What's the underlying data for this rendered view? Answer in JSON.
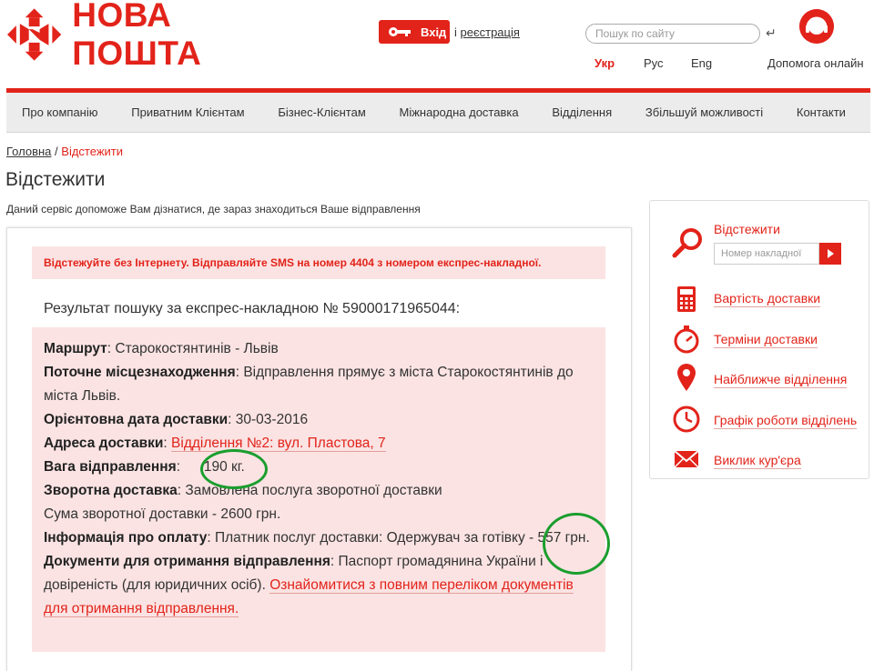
{
  "header": {
    "logo_text": "НОВА ПОШТА",
    "login_label": "Вхід",
    "register_prefix": "і",
    "register_link": "реєстрація",
    "search_placeholder": "Пошук по сайту",
    "languages": [
      "Укр",
      "Рус",
      "Eng"
    ],
    "help_label": "Допомога онлайн",
    "brand_color": "#e2231a"
  },
  "nav": {
    "items": [
      "Про компанію",
      "Приватним Клієнтам",
      "Бізнес-Клієнтам",
      "Міжнародна доставка",
      "Відділення",
      "Збільшуй можливості",
      "Контакти"
    ]
  },
  "breadcrumb": {
    "home": "Головна",
    "separator": "/",
    "current": "Відстежити"
  },
  "page": {
    "title": "Відстежити",
    "subtitle": "Даний сервіс допоможе Вам дізнатися, де зараз знаходиться Ваше відправлення"
  },
  "result": {
    "sms_banner": "Відстежуйте без Інтернету. Відправляйте SMS на номер 4404 з номером експрес-накладної.",
    "heading": "Результат пошуку за експрес-накладною № 59000171965044:",
    "route_label": "Маршрут",
    "route_value": "Старокостянтинів - Львів",
    "location_label": "Поточне місцезнаходження",
    "location_value": "Відправлення прямує з міста Старокостянтинів до міста Львів.",
    "date_label": "Орієнтовна дата доставки",
    "date_value": "30-03-2016",
    "address_label": "Адреса доставки",
    "address_value": "Відділення №2: вул. Пластова, 7",
    "weight_label": "Вага відправлення",
    "weight_value": "190 кг.",
    "return_label": "Зворотна доставка",
    "return_value": "Замовлена послуга зворотної доставки",
    "return_sum": "Сума зворотної доставки - 2600 грн.",
    "payment_label": "Інформація про оплату",
    "payment_value": "Платник послуг доставки: Одержувач за готівку - 557 грн.",
    "docs_label": "Документи для отримання відправлення",
    "docs_value": "Паспорт громадянина України і довіреність (для юридичних осіб).",
    "docs_link": "Ознайомитися з повним переліком документів для отримання відправлення."
  },
  "sidebar": {
    "track_label": "Відстежити",
    "track_placeholder": "Номер накладної",
    "items": [
      "Вартість доставки",
      "Терміни доставки",
      "Найближче відділення",
      "Графік роботи відділень",
      "Виклик кур'єра"
    ],
    "icons": [
      "search-icon",
      "calculator-icon",
      "stopwatch-icon",
      "map-pin-icon",
      "clock-icon",
      "envelope-icon"
    ]
  },
  "annotations": {
    "circle_color": "#1a9e2e"
  }
}
